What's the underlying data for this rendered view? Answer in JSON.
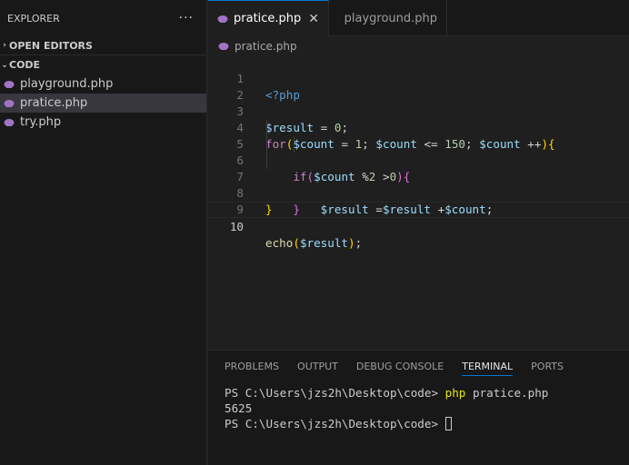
{
  "sidebar": {
    "title": "EXPLORER",
    "more": "···",
    "open_editors": "OPEN EDITORS",
    "folder": "CODE",
    "files": [
      "playground.php",
      "pratice.php",
      "try.php"
    ]
  },
  "tabs": [
    {
      "label": "pratice.php",
      "close": "✕"
    },
    {
      "label": "playground.php"
    }
  ],
  "breadcrumb": "pratice.php",
  "editor": {
    "line_numbers": [
      "1",
      "2",
      "3",
      "4",
      "5",
      "6",
      "7",
      "8",
      "9",
      "10"
    ]
  },
  "panel": {
    "tabs": [
      "PROBLEMS",
      "OUTPUT",
      "DEBUG CONSOLE",
      "TERMINAL",
      "PORTS"
    ],
    "terminal": {
      "prompt1": "PS C:\\Users\\jzs2h\\Desktop\\code> ",
      "cmd_php": "php",
      "cmd_args": " pratice.php",
      "output": "5625",
      "prompt2": "PS C:\\Users\\jzs2h\\Desktop\\code> "
    }
  },
  "colors": {
    "accent": "#0078d4",
    "php_icon": "#a074c4"
  }
}
